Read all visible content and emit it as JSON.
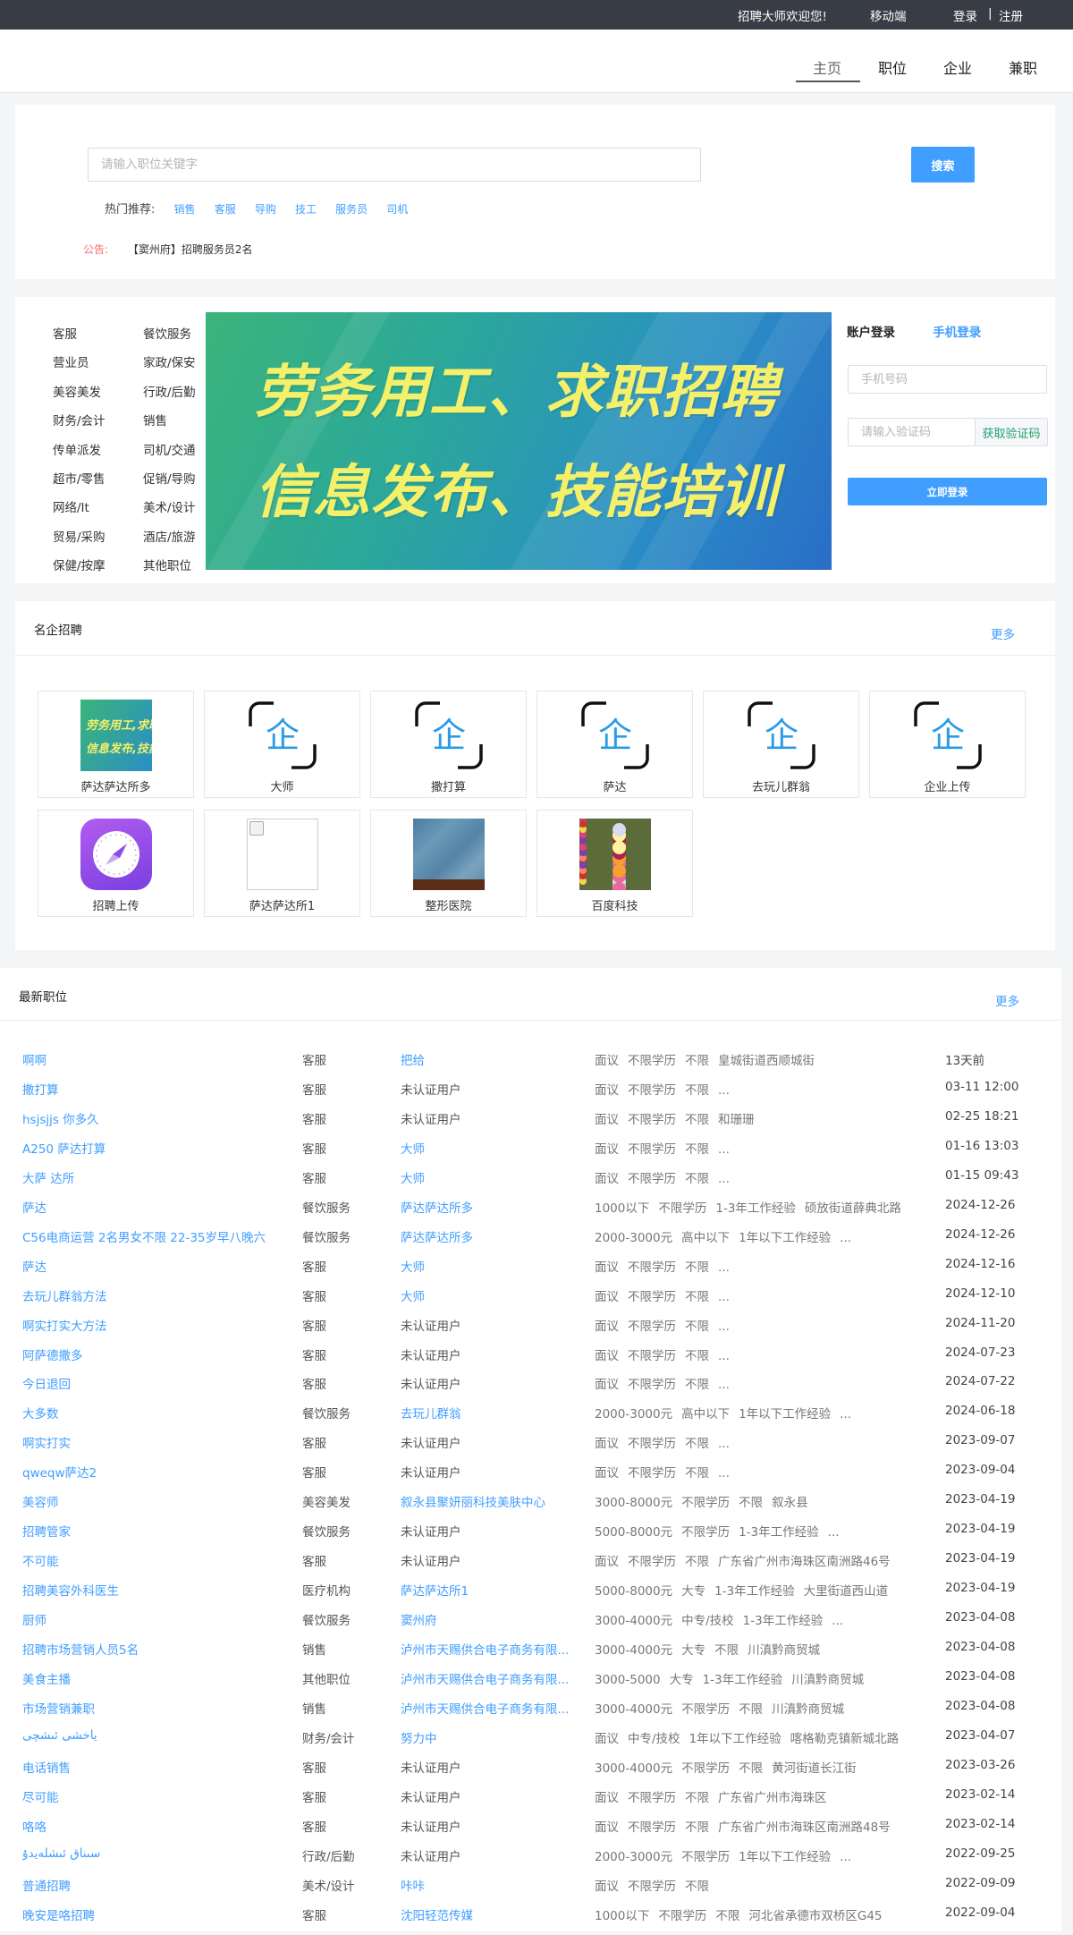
{
  "topbar": {
    "welcome": "招聘大师欢迎您!",
    "mobile": "移动端",
    "login": "登录",
    "separator": "|",
    "register": "注册"
  },
  "nav": {
    "items": [
      {
        "label": "主页",
        "active": true
      },
      {
        "label": "职位",
        "active": false
      },
      {
        "label": "企业",
        "active": false
      },
      {
        "label": "兼职",
        "active": false
      }
    ]
  },
  "search": {
    "placeholder": "请输入职位关键字",
    "button": "搜索",
    "hot_label": "热门推荐:",
    "hot_items": [
      "销售",
      "客服",
      "导购",
      "技工",
      "服务员",
      "司机"
    ],
    "notice_label": "公告:",
    "notice_text": "【窦州府】招聘服务员2名"
  },
  "categories": [
    [
      "客服",
      "餐饮服务"
    ],
    [
      "营业员",
      "家政/保安"
    ],
    [
      "美容美发",
      "行政/后勤"
    ],
    [
      "财务/会计",
      "销售"
    ],
    [
      "传单派发",
      "司机/交通"
    ],
    [
      "超市/零售",
      "促销/导购"
    ],
    [
      "网络/It",
      "美术/设计"
    ],
    [
      "贸易/采购",
      "酒店/旅游"
    ],
    [
      "保健/按摩",
      "其他职位"
    ]
  ],
  "banner": {
    "line1": "劳务用工、求职招聘",
    "line2": "信息发布、技能培训"
  },
  "login": {
    "tab_account": "账户登录",
    "tab_phone": "手机登录",
    "phone_placeholder": "手机号码",
    "code_placeholder": "请输入验证码",
    "get_code": "获取验证码",
    "submit": "立即登录"
  },
  "companies": {
    "title": "名企招聘",
    "more": "更多",
    "qi_char": "企",
    "banner_thumb": [
      "劳务用工,求职招聘",
      "信息发布,技能培训"
    ],
    "items": [
      {
        "name": "萨达萨达所多",
        "logo": "banner-image"
      },
      {
        "name": "大师",
        "logo": "qi-icon"
      },
      {
        "name": "撒打算",
        "logo": "qi-icon"
      },
      {
        "name": "萨达",
        "logo": "qi-icon"
      },
      {
        "name": "去玩儿群翁",
        "logo": "qi-icon"
      },
      {
        "name": "企业上传",
        "logo": "qi-icon"
      },
      {
        "name": "招聘上传",
        "logo": "compass-icon"
      },
      {
        "name": "萨达萨达所1",
        "logo": "broken-image-icon"
      },
      {
        "name": "整形医院",
        "logo": "fabric-photo"
      },
      {
        "name": "百度科技",
        "logo": "flowers-photo"
      }
    ]
  },
  "jobs": {
    "title": "最新职位",
    "more": "更多",
    "rows": [
      {
        "title": "啊啊",
        "category": "客服",
        "company": "把给",
        "linked": true,
        "meta": [
          "面议",
          "不限学历",
          "不限",
          "皇城街道西顺城街"
        ],
        "date": "13天前"
      },
      {
        "title": "撒打算",
        "category": "客服",
        "company": "未认证用户",
        "linked": false,
        "meta": [
          "面议",
          "不限学历",
          "不限",
          "..."
        ],
        "date": "03-11 12:00"
      },
      {
        "title": "hsjsjjs 你多久",
        "category": "客服",
        "company": "未认证用户",
        "linked": false,
        "meta": [
          "面议",
          "不限学历",
          "不限",
          "和珊珊"
        ],
        "date": "02-25 18:21"
      },
      {
        "title": "A250 萨达打算",
        "category": "客服",
        "company": "大师",
        "linked": true,
        "meta": [
          "面议",
          "不限学历",
          "不限",
          "..."
        ],
        "date": "01-16 13:03"
      },
      {
        "title": "大萨 达所",
        "category": "客服",
        "company": "大师",
        "linked": true,
        "meta": [
          "面议",
          "不限学历",
          "不限",
          "..."
        ],
        "date": "01-15 09:43"
      },
      {
        "title": "萨达",
        "category": "餐饮服务",
        "company": "萨达萨达所多",
        "linked": true,
        "meta": [
          "1000以下",
          "不限学历",
          "1-3年工作经验",
          "硕放街道薛典北路"
        ],
        "date": "2024-12-26"
      },
      {
        "title": "C56电商运营 2名男女不限 22-35岁早八晚六",
        "category": "餐饮服务",
        "company": "萨达萨达所多",
        "linked": true,
        "meta": [
          "2000-3000元",
          "高中以下",
          "1年以下工作经验",
          "..."
        ],
        "date": "2024-12-26"
      },
      {
        "title": "萨达",
        "category": "客服",
        "company": "大师",
        "linked": true,
        "meta": [
          "面议",
          "不限学历",
          "不限",
          "..."
        ],
        "date": "2024-12-16"
      },
      {
        "title": "去玩儿群翁方法",
        "category": "客服",
        "company": "大师",
        "linked": true,
        "meta": [
          "面议",
          "不限学历",
          "不限",
          "..."
        ],
        "date": "2024-12-10"
      },
      {
        "title": "啊实打实大方法",
        "category": "客服",
        "company": "未认证用户",
        "linked": false,
        "meta": [
          "面议",
          "不限学历",
          "不限",
          "..."
        ],
        "date": "2024-11-20"
      },
      {
        "title": "阿萨德撒多",
        "category": "客服",
        "company": "未认证用户",
        "linked": false,
        "meta": [
          "面议",
          "不限学历",
          "不限",
          "..."
        ],
        "date": "2024-07-23"
      },
      {
        "title": "今日退回",
        "category": "客服",
        "company": "未认证用户",
        "linked": false,
        "meta": [
          "面议",
          "不限学历",
          "不限",
          "..."
        ],
        "date": "2024-07-22"
      },
      {
        "title": "大多数",
        "category": "餐饮服务",
        "company": "去玩儿群翁",
        "linked": true,
        "meta": [
          "2000-3000元",
          "高中以下",
          "1年以下工作经验",
          "..."
        ],
        "date": "2024-06-18"
      },
      {
        "title": "啊实打实",
        "category": "客服",
        "company": "未认证用户",
        "linked": false,
        "meta": [
          "面议",
          "不限学历",
          "不限",
          "..."
        ],
        "date": "2023-09-07"
      },
      {
        "title": "qweqw萨达2",
        "category": "客服",
        "company": "未认证用户",
        "linked": false,
        "meta": [
          "面议",
          "不限学历",
          "不限",
          "..."
        ],
        "date": "2023-09-04"
      },
      {
        "title": "美容师",
        "category": "美容美发",
        "company": "叙永县聚妍丽科技美肤中心",
        "linked": true,
        "meta": [
          "3000-8000元",
          "不限学历",
          "不限",
          "叙永县"
        ],
        "date": "2023-04-19"
      },
      {
        "title": "招聘管家",
        "category": "餐饮服务",
        "company": "未认证用户",
        "linked": false,
        "meta": [
          "5000-8000元",
          "不限学历",
          "1-3年工作经验",
          "..."
        ],
        "date": "2023-04-19"
      },
      {
        "title": "不可能",
        "category": "客服",
        "company": "未认证用户",
        "linked": false,
        "meta": [
          "面议",
          "不限学历",
          "不限",
          "广东省广州市海珠区南洲路46号"
        ],
        "date": "2023-04-19"
      },
      {
        "title": "招聘美容外科医生",
        "category": "医疗机构",
        "company": "萨达萨达所1",
        "linked": true,
        "meta": [
          "5000-8000元",
          "大专",
          "1-3年工作经验",
          "大里街道西山道"
        ],
        "date": "2023-04-19"
      },
      {
        "title": "厨师",
        "category": "餐饮服务",
        "company": "窦州府",
        "linked": true,
        "meta": [
          "3000-4000元",
          "中专/技校",
          "1-3年工作经验",
          "..."
        ],
        "date": "2023-04-08"
      },
      {
        "title": "招聘市场营销人员5名",
        "category": "销售",
        "company": "泸州市天赐供合电子商务有限...",
        "linked": true,
        "meta": [
          "3000-4000元",
          "大专",
          "不限",
          "川滇黔商贸城"
        ],
        "date": "2023-04-08"
      },
      {
        "title": "美食主播",
        "category": "其他职位",
        "company": "泸州市天赐供合电子商务有限...",
        "linked": true,
        "meta": [
          "3000-5000",
          "大专",
          "1-3年工作经验",
          "川滇黔商贸城"
        ],
        "date": "2023-04-08"
      },
      {
        "title": "市场营销兼职",
        "category": "销售",
        "company": "泸州市天赐供合电子商务有限...",
        "linked": true,
        "meta": [
          "3000-4000元",
          "不限学历",
          "不限",
          "川滇黔商贸城"
        ],
        "date": "2023-04-08"
      },
      {
        "title": "ياخشى ئىشچى",
        "category": "财务/会计",
        "company": "努力中",
        "linked": true,
        "meta": [
          "面议",
          "中专/技校",
          "1年以下工作经验",
          "喀格勒克镇新城北路"
        ],
        "date": "2023-04-07"
      },
      {
        "title": "电话销售",
        "category": "客服",
        "company": "未认证用户",
        "linked": false,
        "meta": [
          "3000-4000元",
          "不限学历",
          "不限",
          "黄河街道长江街"
        ],
        "date": "2023-03-26"
      },
      {
        "title": "尽可能",
        "category": "客服",
        "company": "未认证用户",
        "linked": false,
        "meta": [
          "面议",
          "不限学历",
          "不限",
          "广东省广州市海珠区"
        ],
        "date": "2023-02-14"
      },
      {
        "title": "咯咯",
        "category": "客服",
        "company": "未认证用户",
        "linked": false,
        "meta": [
          "面议",
          "不限学历",
          "不限",
          "广东省广州市海珠区南洲路48号"
        ],
        "date": "2023-02-14"
      },
      {
        "title": "سىناق ئىشلەيدۇ",
        "category": "行政/后勤",
        "company": "未认证用户",
        "linked": false,
        "meta": [
          "2000-3000元",
          "不限学历",
          "1年以下工作经验",
          "..."
        ],
        "date": "2022-09-25"
      },
      {
        "title": "普通招聘",
        "category": "美术/设计",
        "company": "咔咔",
        "linked": true,
        "meta": [
          "面议",
          "不限学历",
          "不限"
        ],
        "date": "2022-09-09"
      },
      {
        "title": "晚安是咯招聘",
        "category": "客服",
        "company": "沈阳轻范传媒",
        "linked": true,
        "meta": [
          "1000以下",
          "不限学历",
          "不限",
          "河北省承德市双桥区G45"
        ],
        "date": "2022-09-04"
      }
    ]
  }
}
